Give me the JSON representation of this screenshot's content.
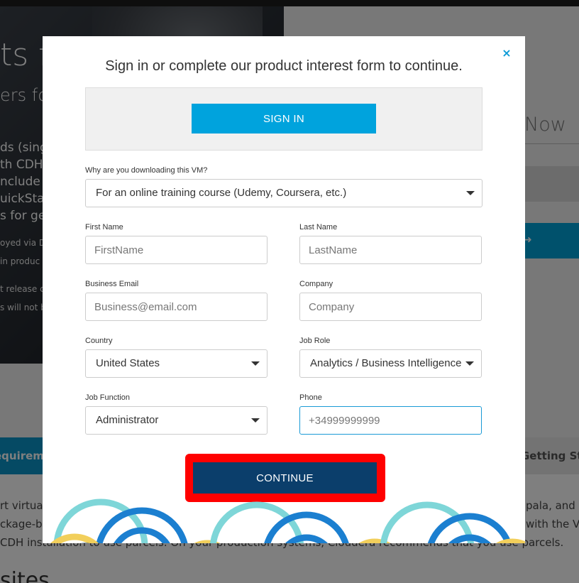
{
  "background": {
    "hero_title": "ts f",
    "hero_subtitle": "ers fo",
    "hero_lines": [
      "ds (single",
      "th CDH",
      "nclude C",
      "uickSta",
      "s for gett"
    ],
    "hero_small": [
      "oyed via D",
      "in produc",
      "t release c",
      "s will not b"
    ],
    "now_text": "Now",
    "tab_left": "equireme",
    "tab_right": "Getting Sta",
    "body_lines": [
      "rt virtua",
      "ckage-b",
      "CDH installation to use parcels. On your production systems, Cloudera recommends that you use parcels.",
      "pala, and C",
      "with the V"
    ],
    "bottom_heading": "sites"
  },
  "modal": {
    "close_symbol": "×",
    "title": "Sign in or complete our product interest form to continue.",
    "signin_label": "SIGN IN",
    "reason": {
      "label": "Why are you downloading this VM?",
      "value": "For an online training course (Udemy, Coursera, etc.)"
    },
    "first_name": {
      "label": "First Name",
      "placeholder": "FirstName"
    },
    "last_name": {
      "label": "Last Name",
      "placeholder": "LastName"
    },
    "email": {
      "label": "Business Email",
      "placeholder": "Business@email.com"
    },
    "company": {
      "label": "Company",
      "placeholder": "Company"
    },
    "country": {
      "label": "Country",
      "value": "United States"
    },
    "job_role": {
      "label": "Job Role",
      "value": "Analytics / Business Intelligence"
    },
    "job_function": {
      "label": "Job Function",
      "value": "Administrator"
    },
    "phone": {
      "label": "Phone",
      "placeholder": "+34999999999"
    },
    "continue_label": "CONTINUE"
  },
  "colors": {
    "signin_blue": "#00a3dd",
    "continue_navy": "#0b3e6b",
    "highlight_red": "#ff0000",
    "close_blue": "#0a9ad6"
  }
}
